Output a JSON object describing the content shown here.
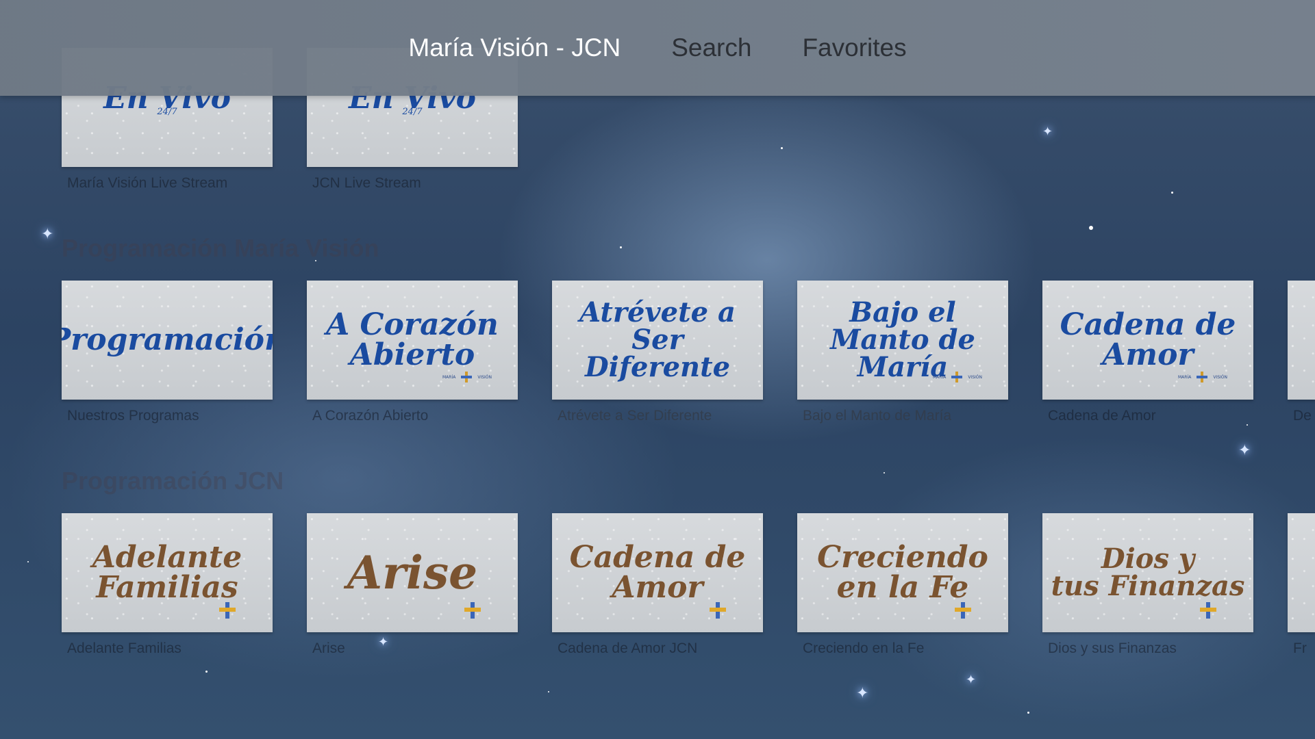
{
  "nav": {
    "tabs": [
      {
        "label": "María Visión - JCN",
        "active": true
      },
      {
        "label": "Search",
        "active": false
      },
      {
        "label": "Favorites",
        "active": false
      }
    ]
  },
  "live_row": {
    "items": [
      {
        "art": "En Vivo",
        "sub": "24/7",
        "caption": "María Visión Live Stream"
      },
      {
        "art": "En Vivo",
        "sub": "24/7",
        "caption": "JCN Live Stream"
      }
    ]
  },
  "sections": [
    {
      "title": "Programación María Visión",
      "items": [
        {
          "art": "Programación",
          "caption": "Nuestros Programas"
        },
        {
          "art": "A Corazón\nAbierto",
          "caption": "A Corazón Abierto"
        },
        {
          "art": "Atrévete a\nSer Diferente",
          "caption": "Atrévete a Ser Diferente"
        },
        {
          "art": "Bajo el\nManto de María",
          "caption": "Bajo el Manto de María"
        },
        {
          "art": "Cadena de\nAmor",
          "caption": "Cadena de Amor"
        },
        {
          "art": "",
          "caption": "De"
        }
      ]
    },
    {
      "title": "Programación JCN",
      "items": [
        {
          "art": "Adelante\nFamilias",
          "caption": "Adelante Familias"
        },
        {
          "art": "Arise",
          "caption": "Arise"
        },
        {
          "art": "Cadena de\nAmor",
          "caption": "Cadena de Amor JCN"
        },
        {
          "art": "Creciendo\nen la Fe",
          "caption": "Creciendo en la Fe"
        },
        {
          "art": "Dios y\ntus Finanzas",
          "caption": "Dios y sus Finanzas"
        },
        {
          "art": "",
          "caption": "Fr"
        }
      ]
    }
  ],
  "logos": {
    "mv_left": "MARÍA",
    "mv_right": "VISIÓN"
  },
  "colors": {
    "accent_blue": "#1a4ba0",
    "accent_brown": "#7a5330",
    "bar": "#78828e"
  }
}
